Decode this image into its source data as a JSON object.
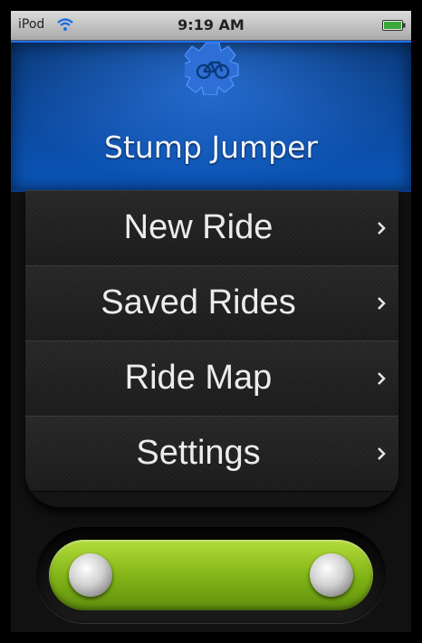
{
  "status_bar": {
    "carrier": "iPod",
    "time": "9:19 AM",
    "wifi_icon": "wifi-icon",
    "battery_icon": "battery-icon"
  },
  "header": {
    "title": "Stump Jumper",
    "logo_icon": "gear-bicycle-icon"
  },
  "menu": {
    "items": [
      {
        "label": "New Ride",
        "icon": "chevron-right-icon"
      },
      {
        "label": "Saved Rides",
        "icon": "chevron-right-icon"
      },
      {
        "label": "Ride Map",
        "icon": "chevron-right-icon"
      },
      {
        "label": "Settings",
        "icon": "chevron-right-icon"
      }
    ]
  },
  "colors": {
    "header_blue": "#0c4aa0",
    "slider_green": "#7fb216",
    "menu_background": "#1a1a1a"
  }
}
